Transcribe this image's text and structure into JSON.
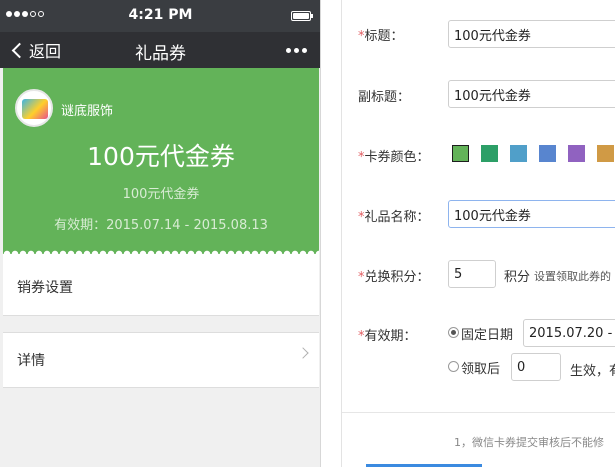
{
  "phone": {
    "status_bar": {
      "time": "4:21 PM"
    },
    "nav": {
      "back_label": "返回",
      "title": "礼品券"
    },
    "card": {
      "brand_name": "谜底服饰",
      "title": "100元代金券",
      "subtitle": "100元代金券",
      "validity": "有效期：2015.07.14 - 2015.08.13",
      "color": "#63b359"
    },
    "rows": {
      "sales_label": "销券设置",
      "detail_label": "详情"
    }
  },
  "form": {
    "title_label": "标题：",
    "title_value": "100元代金券",
    "subtitle_label": "副标题：",
    "subtitle_value": "100元代金券",
    "color_label": "卡券颜色：",
    "colors": [
      "#63b359",
      "#2c9f67",
      "#509fc9",
      "#5885cf",
      "#9062c0",
      "#d09a45"
    ],
    "gift_name_label": "礼品名称：",
    "gift_name_value": "100元代金券",
    "points_label": "兑换积分：",
    "points_value": "5",
    "points_unit": "积分",
    "points_hint": "设置领取此券的",
    "validity_label": "有效期：",
    "fixed_date_label": "固定日期",
    "fixed_date_value": "2015.07.20 -",
    "after_claim_label": "领取后",
    "after_claim_value": "0",
    "after_claim_suffix": "生效，有",
    "footer_note": "1，微信卡券提交审核后不能修"
  }
}
